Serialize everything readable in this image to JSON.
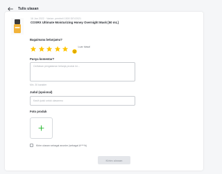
{
  "header": {
    "title": "Tulis ulasan"
  },
  "product": {
    "meta": "16 Jan 2022 · Varian: pembeli 1500 DEV2021",
    "name": "COSRX Ultimate Moisturizing Honey Overnight Mask [50 mL]"
  },
  "rating": {
    "question": "Bagaimana belanjamu?",
    "value": 5,
    "max": 5,
    "label": "Luar biasa!",
    "star_color": "#ffc400"
  },
  "comment": {
    "label": "Punya komentar?",
    "placeholder": "Ceritakan pengalaman belanja produk ini...",
    "hint": "Min. 30 karakter"
  },
  "title_field": {
    "label": "Judul (opsional)",
    "placeholder": "Kasih judul untuk ulasanmu"
  },
  "photo": {
    "label": "Foto produk",
    "add_icon": "plus-icon",
    "accent": "#03ac0e"
  },
  "anonymous": {
    "label": "Kirim ulasan sebagai anonim (sebagai A****b)",
    "checked": false
  },
  "submit": {
    "label": "Kirim ulasan"
  }
}
